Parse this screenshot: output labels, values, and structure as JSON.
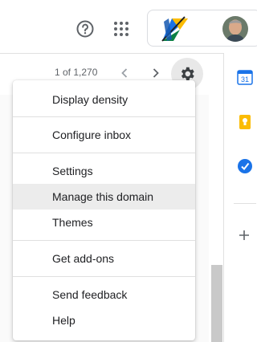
{
  "header": {
    "help_icon": "help-circle-icon",
    "apps_icon": "apps-grid-icon",
    "logo_colors": [
      "#1a73e8",
      "#fbbc04",
      "#0b8043",
      "#202124"
    ]
  },
  "toolbar": {
    "page_count": "1 of 1,270",
    "prev_icon": "chevron-left-icon",
    "next_icon": "chevron-right-icon",
    "settings_icon": "gear-icon"
  },
  "settings_menu": {
    "items": [
      {
        "label": "Display density"
      },
      {
        "label": "Configure inbox"
      },
      {
        "label": "Settings"
      },
      {
        "label": "Manage this domain",
        "highlighted": true
      },
      {
        "label": "Themes"
      },
      {
        "label": "Get add-ons"
      },
      {
        "label": "Send feedback"
      },
      {
        "label": "Help"
      }
    ]
  },
  "side_panel": {
    "apps": [
      {
        "icon": "calendar-icon",
        "text": "31",
        "color": "#1a73e8"
      },
      {
        "icon": "keep-icon",
        "color": "#fbbc04"
      },
      {
        "icon": "tasks-icon",
        "color": "#1a73e8"
      }
    ],
    "add_icon": "plus-icon"
  }
}
